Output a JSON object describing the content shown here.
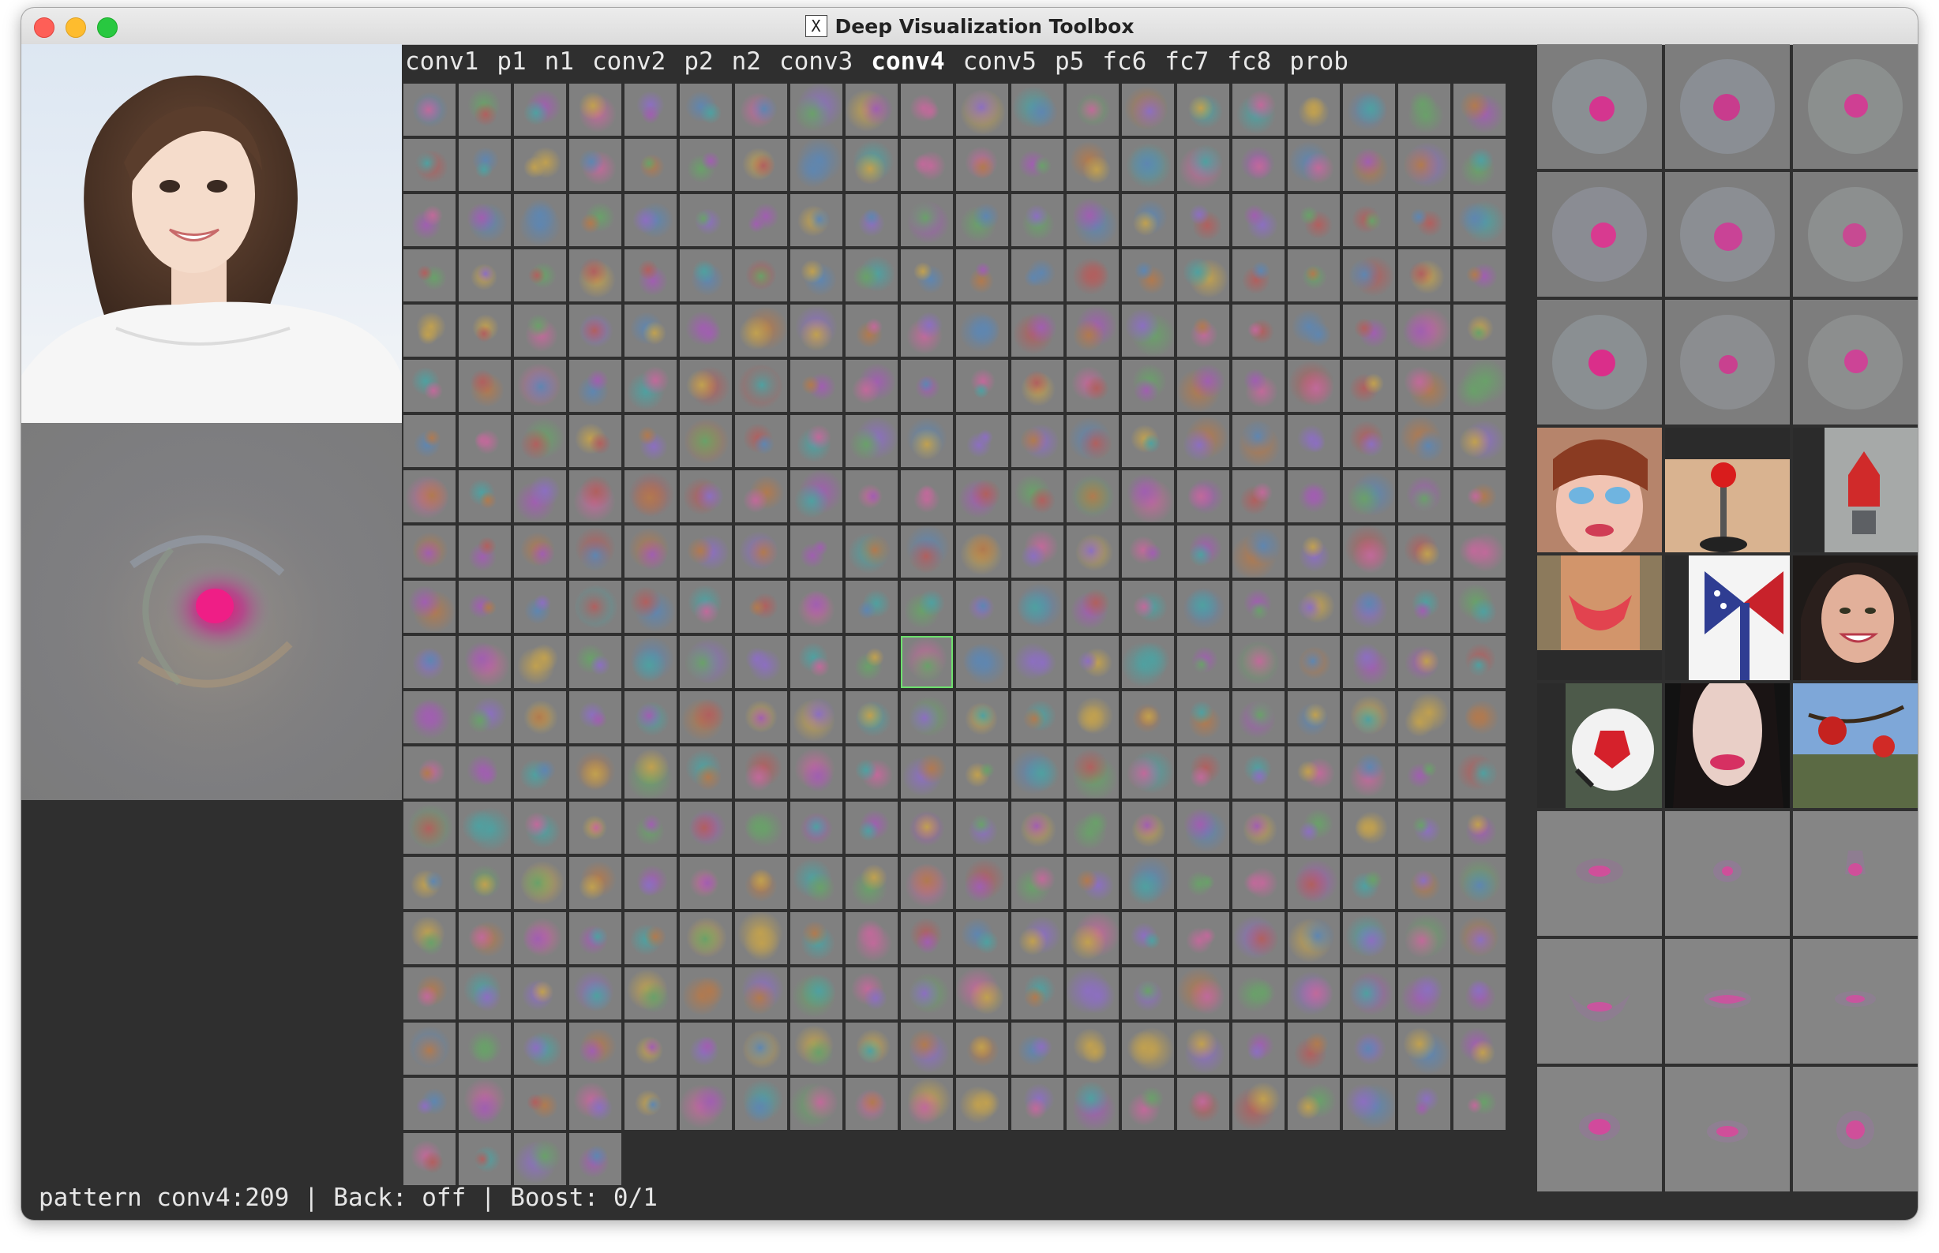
{
  "window": {
    "title": "Deep Visualization Toolbox",
    "title_icon": "x11-icon"
  },
  "layers": [
    {
      "name": "conv1",
      "active": false
    },
    {
      "name": "p1",
      "active": false
    },
    {
      "name": "n1",
      "active": false
    },
    {
      "name": "conv2",
      "active": false
    },
    {
      "name": "p2",
      "active": false
    },
    {
      "name": "n2",
      "active": false
    },
    {
      "name": "conv3",
      "active": false
    },
    {
      "name": "conv4",
      "active": true
    },
    {
      "name": "conv5",
      "active": false
    },
    {
      "name": "p5",
      "active": false
    },
    {
      "name": "fc6",
      "active": false
    },
    {
      "name": "fc7",
      "active": false
    },
    {
      "name": "fc8",
      "active": false
    },
    {
      "name": "prob",
      "active": false
    }
  ],
  "grid": {
    "columns": 20,
    "full_rows": 19,
    "last_row_count": 4,
    "selected_index": 209,
    "cell_color": "#808080",
    "selected_color": "#6ee06e"
  },
  "status": {
    "mode": "pattern conv4:209",
    "separator": " | ",
    "back": "Back: off",
    "boost": "Boost: 0/1"
  },
  "colors": {
    "background": "#2f2f2f",
    "text": "#e8e8e8",
    "tile_gray": "#808080"
  },
  "right_panel": {
    "sections": [
      "optimized-images",
      "top-activation-images",
      "deconv-images"
    ],
    "top_images": [
      "doll-face",
      "joystick",
      "red-object",
      "bikini",
      "flag-bow",
      "smiling-woman",
      "soccer-ball",
      "woman-lips",
      "red-berries"
    ]
  }
}
